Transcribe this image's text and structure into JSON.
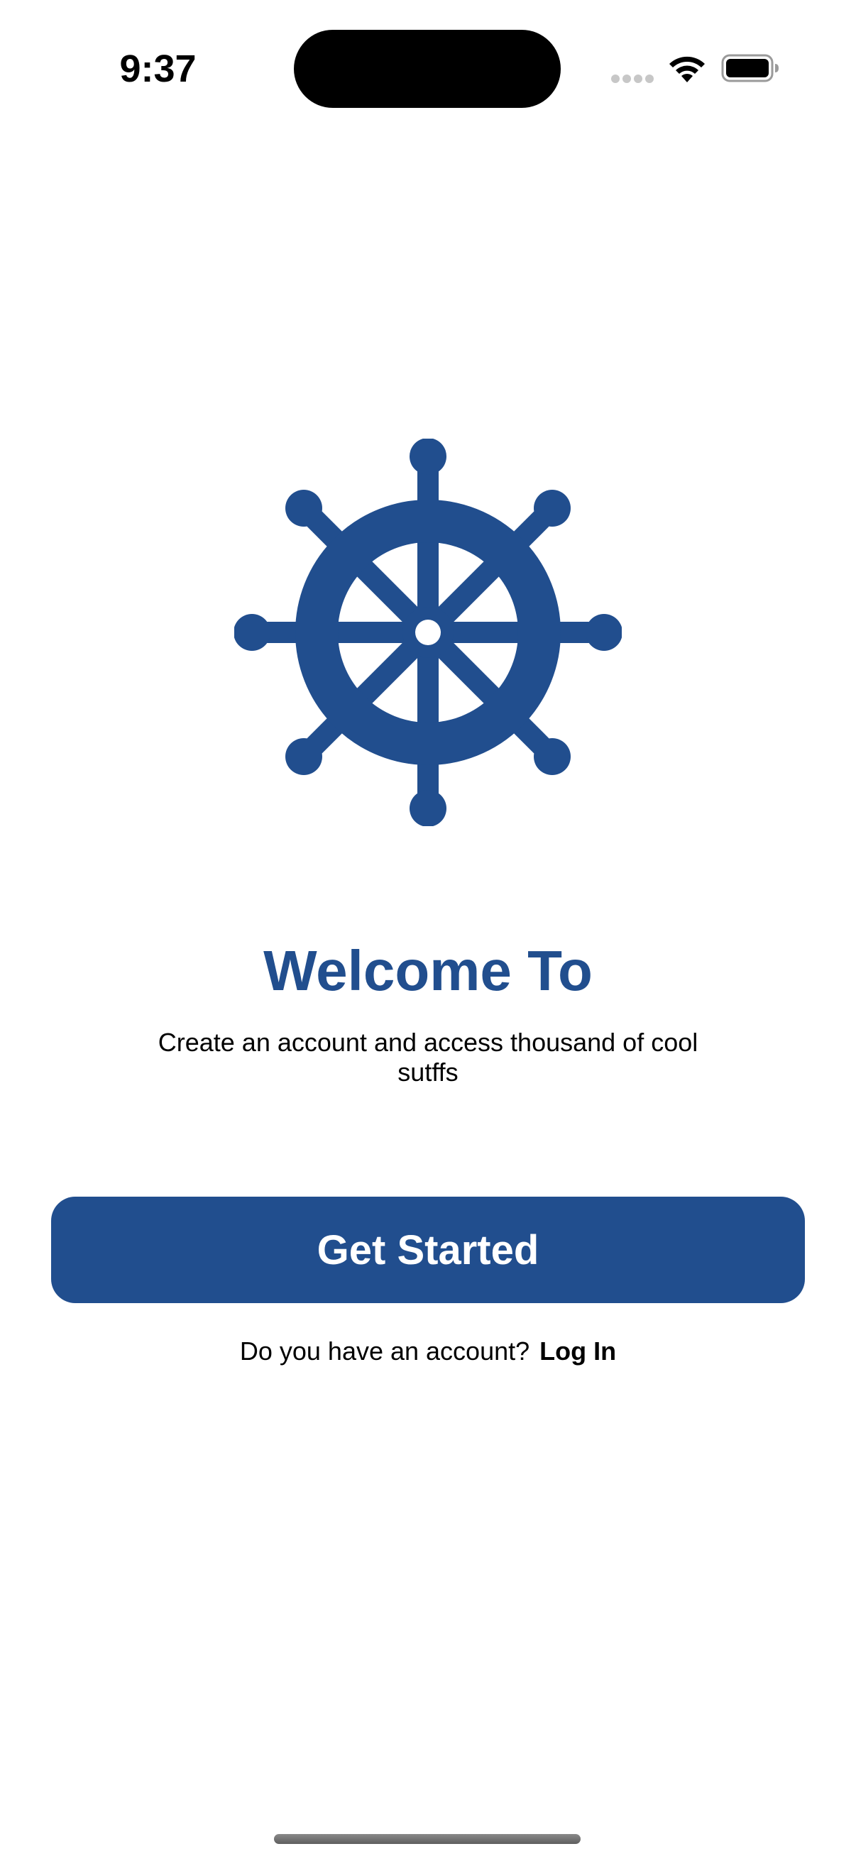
{
  "status_bar": {
    "time": "9:37",
    "icons": [
      "cellular-signal-icon",
      "wifi-icon",
      "battery-icon"
    ]
  },
  "logo": {
    "icon": "ship-wheel-icon",
    "color": "#214e8e"
  },
  "welcome": {
    "title": "Welcome To",
    "subtitle": "Create an account and access thousand of cool sutffs"
  },
  "actions": {
    "primary_label": "Get Started",
    "account_prompt": "Do you have an account?",
    "login_label": "Log In"
  },
  "colors": {
    "accent": "#214e8e",
    "background": "#ffffff",
    "button_text": "#ffffff"
  }
}
